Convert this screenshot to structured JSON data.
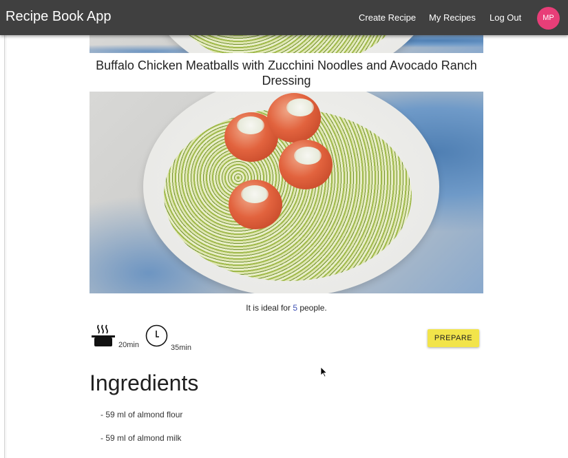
{
  "appbar": {
    "title": "Recipe Book App",
    "nav": [
      "Create Recipe",
      "My Recipes",
      "Log Out"
    ],
    "avatar_initials": "MP",
    "avatar_color": "#e83e78"
  },
  "recipe": {
    "title": "Buffalo Chicken Meatballs with Zucchini Noodles and Avocado Ranch Dressing",
    "servings_prefix": "It is ideal for ",
    "servings_count": "5",
    "servings_suffix": " people.",
    "cook_time": "20min",
    "total_time": "35min",
    "prepare_label": "PREPARE",
    "prepare_color": "#f2e44a"
  },
  "ingredients": {
    "heading": "Ingredients",
    "items": [
      "- 59 ml of almond flour",
      "- 59 ml of almond milk"
    ]
  },
  "icons": {
    "cook": "cooking-pot-icon",
    "clock": "clock-icon"
  }
}
